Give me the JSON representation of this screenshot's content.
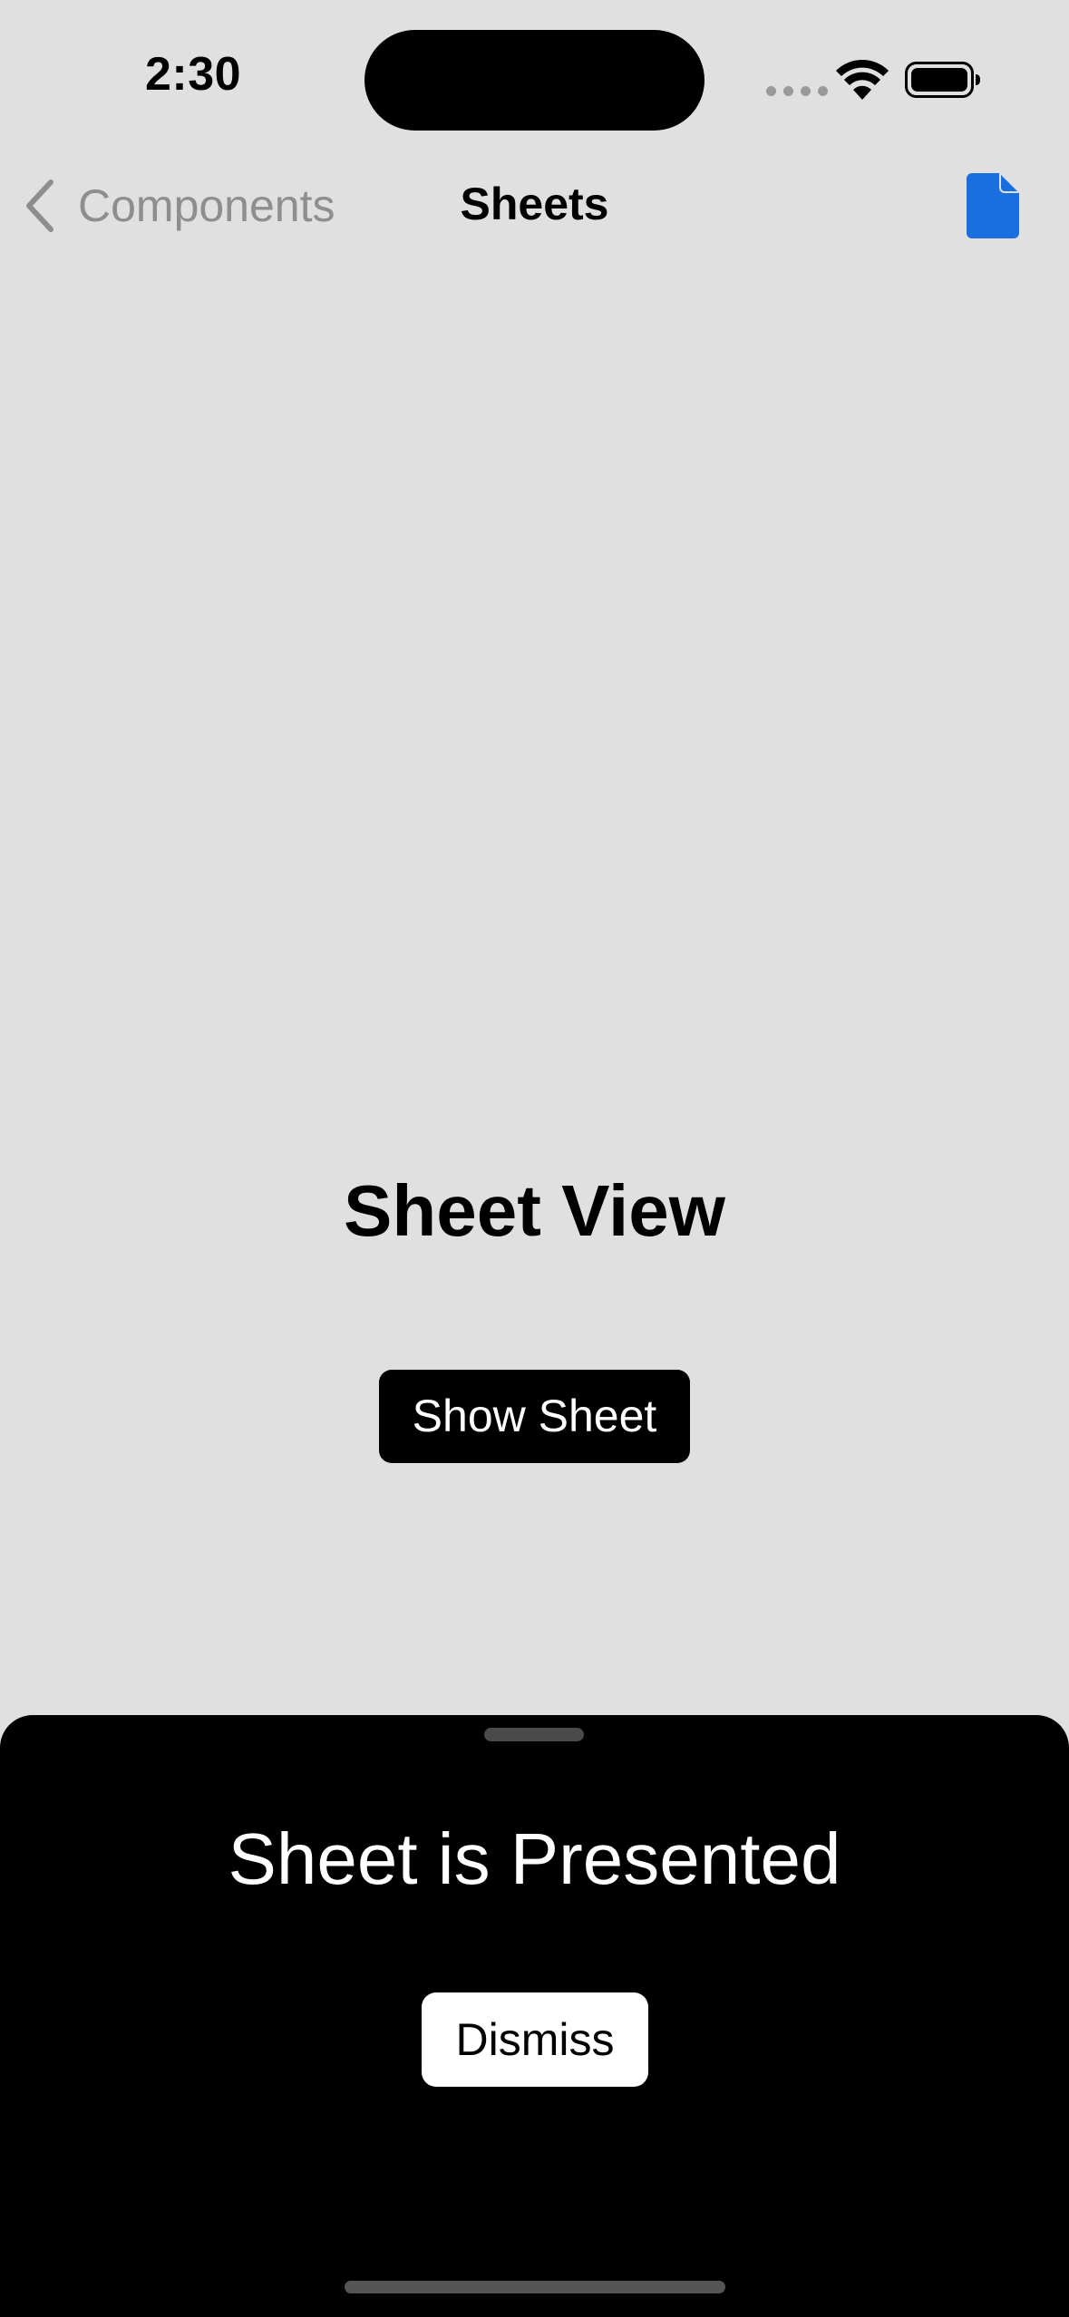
{
  "status_bar": {
    "time": "2:30"
  },
  "nav": {
    "back_label": "Components",
    "title": "Sheets",
    "right_icon": "document-icon",
    "accent_color": "#1a6fe0"
  },
  "main": {
    "title": "Sheet View",
    "show_button_label": "Show Sheet"
  },
  "sheet": {
    "title": "Sheet is Presented",
    "dismiss_label": "Dismiss"
  }
}
